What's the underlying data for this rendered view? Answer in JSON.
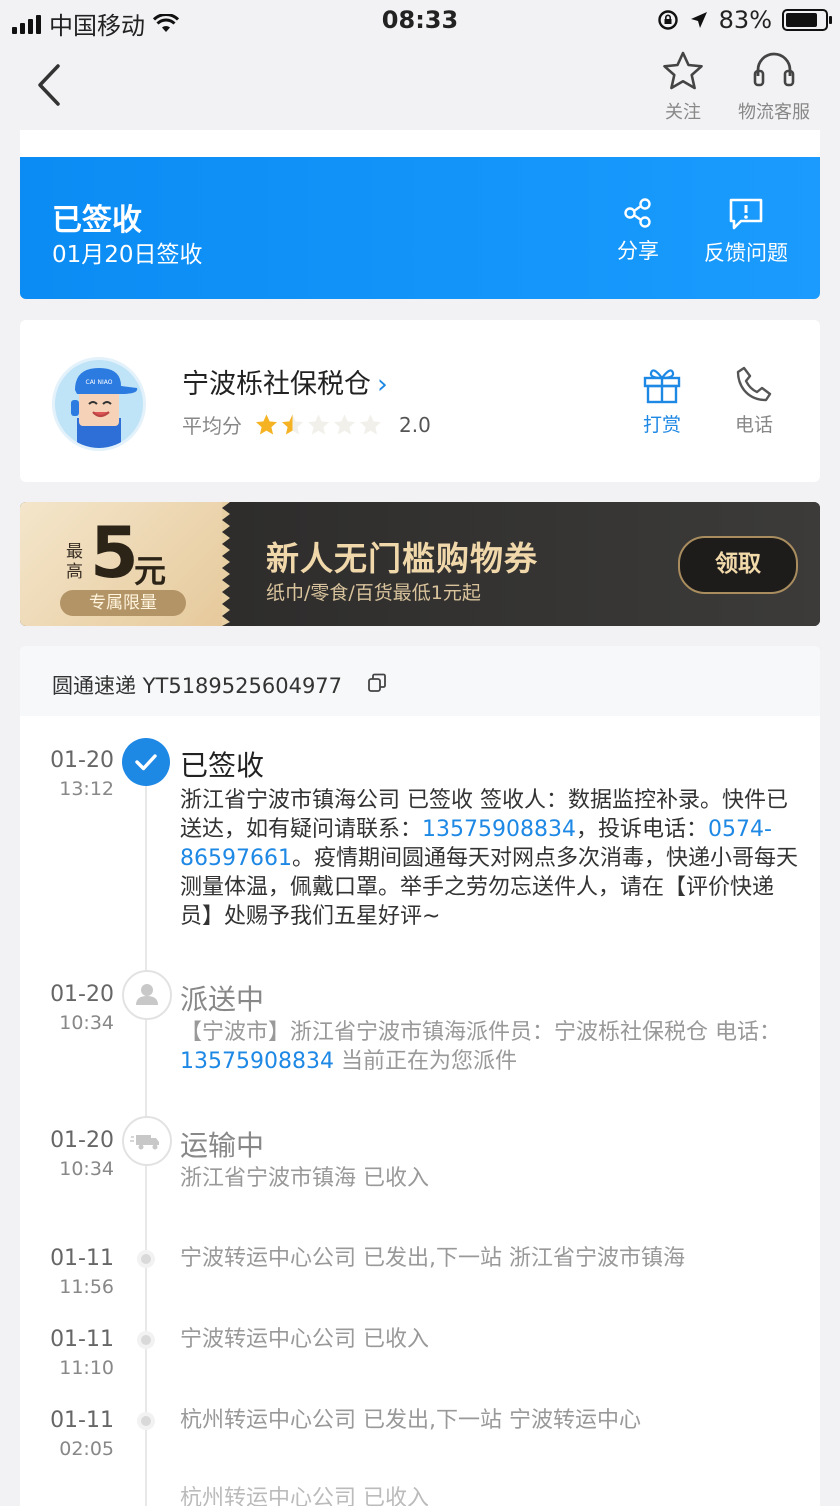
{
  "status_bar": {
    "carrier": "中国移动",
    "time": "08:33",
    "battery": "83%"
  },
  "nav": {
    "follow_label": "关注",
    "service_label": "物流客服"
  },
  "status_card": {
    "title": "已签收",
    "subtitle": "01月20日签收",
    "share_label": "分享",
    "feedback_label": "反馈问题"
  },
  "courier": {
    "name": "宁波栎社保税仓",
    "rating_label": "平均分",
    "rating_value": 2.0,
    "rating_text": "2.0",
    "tip_label": "打赏",
    "phone_label": "电话",
    "avatar_cap_text": "CAI NIAO"
  },
  "coupon": {
    "small_text": "最高",
    "amount": "5",
    "unit": "元",
    "badge": "专属限量",
    "title": "新人无门槛购物券",
    "subtitle": "纸巾/零食/百货最低1元起",
    "claim_label": "领取"
  },
  "tracking": {
    "header": "圆通速递 YT5189525604977",
    "events": [
      {
        "date": "01-20",
        "time": "13:12",
        "title": "已签收",
        "body_parts": [
          "浙江省宁波市镇海公司 已签收 签收人：数据监控补录。快件已送达，如有疑问请联系：",
          "13575908834",
          "，投诉电话：",
          "0574-86597661",
          "。疫情期间圆通每天对网点多次消毒，快递小哥每天测量体温，佩戴口罩。举手之劳勿忘送件人，请在【评价快递员】处赐予我们五星好评~"
        ]
      },
      {
        "date": "01-20",
        "time": "10:34",
        "title": "派送中",
        "body_parts": [
          "【宁波市】浙江省宁波市镇海派件员：宁波栎社保税仓 电话：",
          "13575908834",
          " 当前正在为您派件"
        ]
      },
      {
        "date": "01-20",
        "time": "10:34",
        "title": "运输中",
        "body": "浙江省宁波市镇海 已收入"
      },
      {
        "date": "01-11",
        "time": "11:56",
        "body": "宁波转运中心公司 已发出,下一站 浙江省宁波市镇海"
      },
      {
        "date": "01-11",
        "time": "11:10",
        "body": "宁波转运中心公司 已收入"
      },
      {
        "date": "01-11",
        "time": "02:05",
        "body": "杭州转运中心公司 已发出,下一站 宁波转运中心"
      },
      {
        "body": "杭州转运中心公司 已收入"
      }
    ]
  },
  "colors": {
    "accent": "#1e88e5",
    "status_blue": "#0a8cf4",
    "gold": "#f1d8ab"
  }
}
